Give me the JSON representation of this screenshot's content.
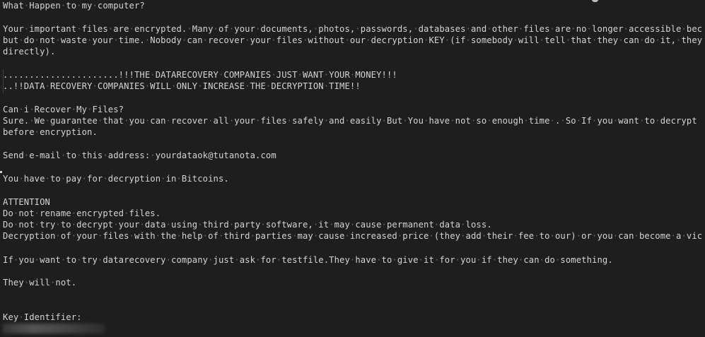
{
  "document": {
    "lines": [
      "What Happen to my computer?",
      "",
      "Your important files are encrypted. Many of your documents, photos, passwords, databases and other files are no longer accessible bec",
      "but do not waste your time. Nobody can recover your files without our decryption KEY (if somebody will tell that they can do it, they",
      "directly).",
      "",
      "......................!!!THE DATARECOVERY COMPANIES JUST WANT YOUR MONEY!!!",
      "..!!DATA RECOVERY COMPANIES WILL ONLY INCREASE THE DECRYPTION TIME!!",
      "",
      "Can i Recover My Files?",
      "Sure. We guarantee that you can recover all your files safely and easily But You have not so enough time . So If you want to decrypt",
      "before encryption.",
      "",
      "Send e-mail to this address: yourdataok@tutanota.com",
      "",
      "You have to pay for decryption in Bitcoins.",
      "",
      "ATTENTION",
      "Do not rename encrypted files.",
      "Do not try to decrypt your data using third party software, it may cause permanent data loss.",
      "Decryption of your files with the help of third parties may cause increased price (they add their fee to our) or you can become a vic",
      "",
      "If you want to try datarecovery company just ask for testfile.They have to give it for you if they can do something.",
      "",
      "They will not.",
      "",
      "",
      "Key Identifier:"
    ]
  },
  "colors": {
    "background": "#1e1e1e",
    "text": "#d4d4d4",
    "whitespace_dots": "#6a6a6a"
  }
}
